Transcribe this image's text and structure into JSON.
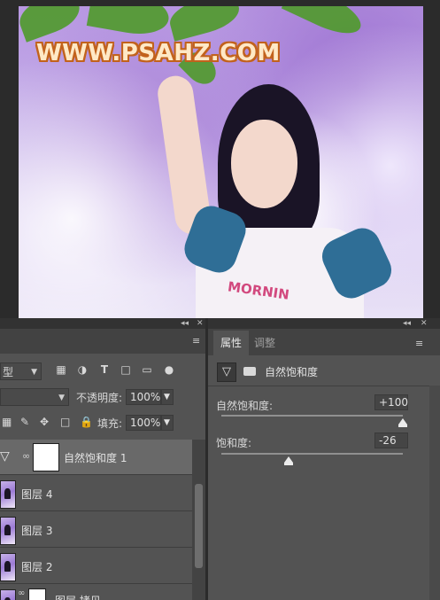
{
  "watermark": "WWW.PSAHZ.COM",
  "shirt_text": "MORNIN",
  "layers_panel": {
    "collapse": "◂◂",
    "close": "✕",
    "kind_filter": "型",
    "opacity_label": "不透明度:",
    "opacity_value": "100%",
    "fill_label": "填充:",
    "fill_value": "100%",
    "adjustment_layer": "自然饱和度 1",
    "layers": [
      "图层 4",
      "图层 3",
      "图层 2"
    ],
    "partial_layer": "图层 拷贝"
  },
  "properties_panel": {
    "collapse": "◂◂",
    "close": "✕",
    "tab_properties": "属性",
    "tab_adjustments": "调整",
    "title": "自然饱和度",
    "vibrance_label": "自然饱和度:",
    "vibrance_value": "+100",
    "vibrance_fraction": 1.0,
    "saturation_label": "饱和度:",
    "saturation_value": "-26",
    "saturation_fraction": 0.37
  },
  "colors": {
    "panel_bg": "#535353",
    "selected_layer": "#696969",
    "watermark_fill": "#ffe9c6",
    "watermark_outline": "#c2621c"
  }
}
